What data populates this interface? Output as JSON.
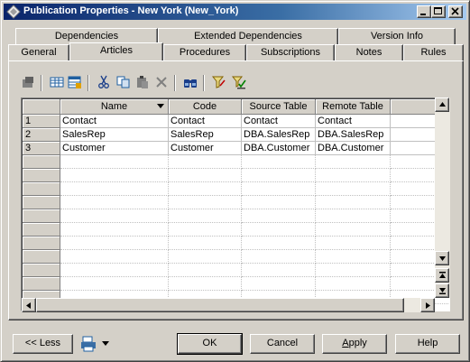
{
  "window": {
    "title": "Publication Properties - New York (New_York)"
  },
  "tabs": {
    "top_row": [
      "Dependencies",
      "Extended Dependencies",
      "Version Info"
    ],
    "bottom_row": [
      "General",
      "Articles",
      "Procedures",
      "Subscriptions",
      "Notes",
      "Rules"
    ],
    "active": "Articles"
  },
  "toolbar": {
    "icons": [
      "properties-icon",
      "add-columns-icon",
      "add-row-icon",
      "cut-icon",
      "copy-icon",
      "paste-icon",
      "delete-icon",
      "find-icon",
      "filter-icon",
      "customize-columns-icon"
    ]
  },
  "grid": {
    "columns": [
      "Name",
      "Code",
      "Source Table",
      "Remote Table"
    ],
    "rows": [
      {
        "num": "1",
        "name": "Contact",
        "code": "Contact",
        "source": "Contact",
        "remote": "Contact"
      },
      {
        "num": "2",
        "name": "SalesRep",
        "code": "SalesRep",
        "source": "DBA.SalesRep",
        "remote": "DBA.SalesRep"
      },
      {
        "num": "3",
        "name": "Customer",
        "code": "Customer",
        "source": "DBA.Customer",
        "remote": "DBA.Customer"
      }
    ]
  },
  "buttons": {
    "less": "<< Less",
    "ok": "OK",
    "cancel": "Cancel",
    "apply": "Apply",
    "help": "Help"
  }
}
